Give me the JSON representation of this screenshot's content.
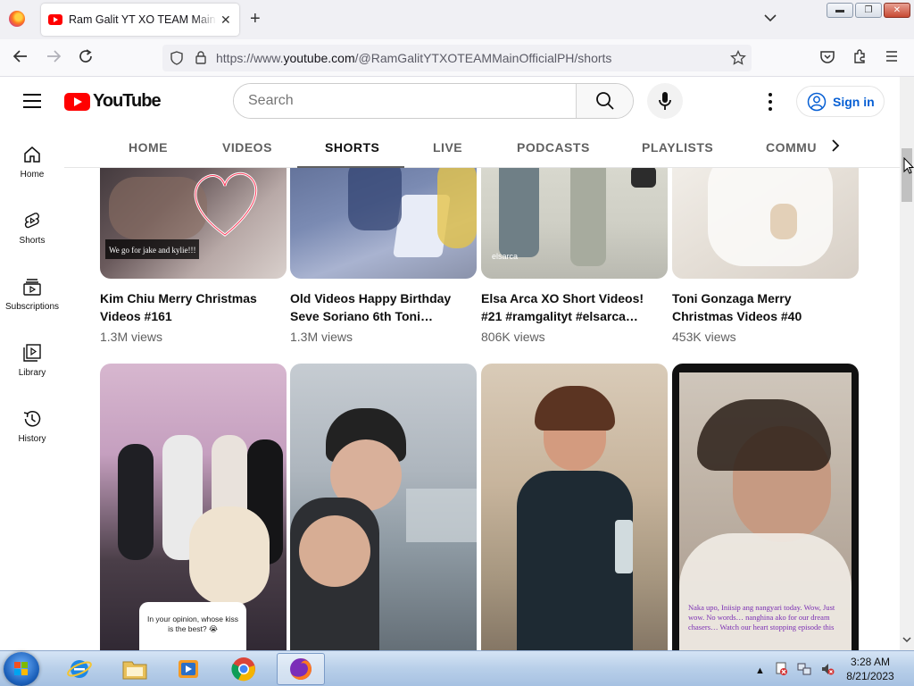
{
  "browser": {
    "tab_title": "Ram Galit YT XO TEAM Main Official",
    "url_prefix": "https://www.",
    "url_domain": "youtube.com",
    "url_path": "/@RamGalitYTXOTEAMMainOfficialPH/shorts"
  },
  "header": {
    "logo_text": "YouTube",
    "search_placeholder": "Search",
    "sign_in_label": "Sign in"
  },
  "sidebar": {
    "items": [
      {
        "label": "Home",
        "icon": "home-icon"
      },
      {
        "label": "Shorts",
        "icon": "shorts-icon"
      },
      {
        "label": "Subscriptions",
        "icon": "subscriptions-icon"
      },
      {
        "label": "Library",
        "icon": "library-icon"
      },
      {
        "label": "History",
        "icon": "history-icon"
      }
    ]
  },
  "channel_tabs": [
    "HOME",
    "VIDEOS",
    "SHORTS",
    "LIVE",
    "PODCASTS",
    "PLAYLISTS",
    "COMMU"
  ],
  "active_tab": "SHORTS",
  "videos": [
    {
      "title": "Kim Chiu Merry Christmas Videos #161",
      "views": "1.3M views",
      "overlay": "We go for jake and kylie!!!"
    },
    {
      "title": "Old Videos Happy Birthday Seve Soriano 6th Toni…",
      "views": "1.3M views"
    },
    {
      "title": "Elsa Arca XO Short Videos! #21 #ramgalityt #elsarca…",
      "views": "806K views",
      "overlay": "elsarca"
    },
    {
      "title": "Toni Gonzaga Merry Christmas Videos #40",
      "views": "453K views"
    }
  ],
  "second_row_overlays": {
    "card1_question": "In your opinion, whose kiss is the best? 😭",
    "card4_caption": "Naka upo, Iniisip ang nangyari today. Wow, Just wow. No words… nanghina ako for our dream chasers… Watch our heart stopping episode this"
  },
  "taskbar": {
    "time": "3:28 AM",
    "date": "8/21/2023"
  }
}
